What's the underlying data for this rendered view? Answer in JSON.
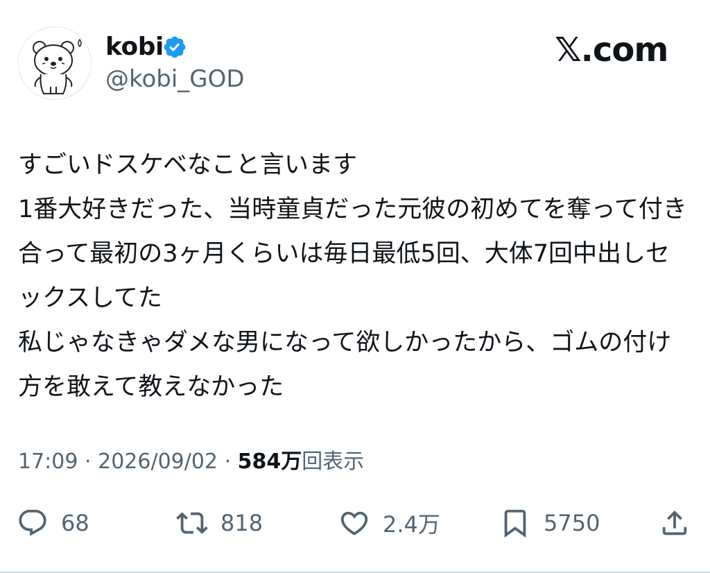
{
  "header": {
    "display_name": "kobi",
    "handle": "@kobi_GOD",
    "brand": "𝕏.com",
    "avatar_icon": "bear-avatar-icon",
    "verified_icon": "verified-badge-icon",
    "verified_color": "#1d9bf0"
  },
  "tweet": {
    "text": "すごいドスケベなこと言います\n1番大好きだった、当時童貞だった元彼の初めてを奪って付き合って最初の3ヶ月くらいは毎日最低5回、大体7回中出しセックスしてた\n私じゃなきゃダメな男になって欲しかったから、ゴムの付け方を敢えて教えなかった"
  },
  "meta": {
    "time": "17:09",
    "separator": "·",
    "date": "2026/09/02",
    "views_count": "584万",
    "views_label": "回表示"
  },
  "actions": {
    "reply_count": "68",
    "retweet_count": "818",
    "like_count": "2.4万",
    "bookmark_count": "5750",
    "reply_icon": "reply-icon",
    "retweet_icon": "retweet-icon",
    "like_icon": "heart-icon",
    "bookmark_icon": "bookmark-icon",
    "share_icon": "share-icon"
  }
}
